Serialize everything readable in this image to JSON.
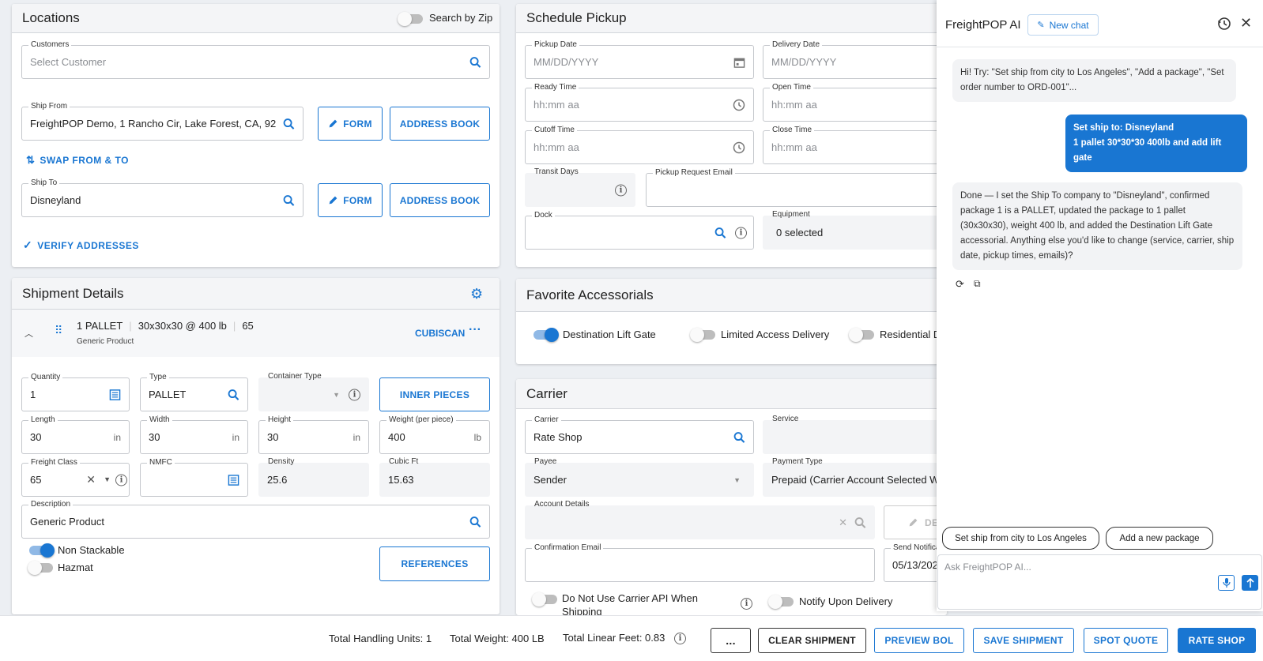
{
  "locations": {
    "title": "Locations",
    "search_by_zip": "Search by Zip",
    "customers_label": "Customers",
    "customers_placeholder": "Select Customer",
    "ship_from_label": "Ship From",
    "ship_from_value": "FreightPOP Demo, 1 Rancho Cir, Lake Forest, CA, 92...",
    "form_label": "FORM",
    "address_book_label": "ADDRESS BOOK",
    "swap_label": "SWAP FROM & TO",
    "ship_to_label": "Ship To",
    "ship_to_value": "Disneyland",
    "verify_label": "VERIFY ADDRESSES"
  },
  "shipment": {
    "title": "Shipment Details",
    "package_summary": "1 PALLET",
    "package_dims": "30x30x30 @ 400 lb",
    "package_class": "65",
    "package_sub": "Generic Product",
    "cubiscan_label": "CUBISCAN",
    "quantity_label": "Quantity",
    "quantity_value": "1",
    "type_label": "Type",
    "type_value": "PALLET",
    "container_label": "Container Type",
    "inner_pieces_label": "INNER PIECES",
    "length_label": "Length",
    "length_value": "30",
    "width_label": "Width",
    "width_value": "30",
    "height_label": "Height",
    "height_value": "30",
    "weight_label": "Weight (per piece)",
    "weight_value": "400",
    "unit_in": "in",
    "unit_lb": "lb",
    "class_label": "Freight Class",
    "class_value": "65",
    "nmfc_label": "NMFC",
    "density_label": "Density",
    "density_value": "25.6",
    "cubic_label": "Cubic Ft",
    "cubic_value": "15.63",
    "desc_label": "Description",
    "desc_value": "Generic Product",
    "non_stackable_label": "Non Stackable",
    "hazmat_label": "Hazmat",
    "references_label": "REFERENCES"
  },
  "pickup": {
    "title": "Schedule Pickup",
    "pickup_date_label": "Pickup Date",
    "date_placeholder": "MM/DD/YYYY",
    "delivery_date_label": "Delivery Date",
    "ready_label": "Ready Time",
    "time_placeholder": "hh:mm aa",
    "open_label": "Open Time",
    "cutoff_label": "Cutoff Time",
    "close_label": "Close Time",
    "transit_label": "Transit Days",
    "pickup_email_label": "Pickup Request Email",
    "dock_label": "Dock",
    "equipment_label": "Equipment",
    "equipment_value": "0 selected"
  },
  "accessorials": {
    "title": "Favorite Accessorials",
    "dest_lift": "Destination Lift Gate",
    "limited": "Limited Access Delivery",
    "residential": "Residential D"
  },
  "carrier": {
    "title": "Carrier",
    "carrier_label": "Carrier",
    "carrier_value": "Rate Shop",
    "service_label": "Service",
    "payee_label": "Payee",
    "payee_value": "Sender",
    "payment_label": "Payment Type",
    "payment_value": "Prepaid (Carrier Account Selected W",
    "account_label": "Account Details",
    "de_label": "DE",
    "confirm_label": "Confirmation Email",
    "send_label": "Send Notificat",
    "send_value": "05/13/202",
    "no_api_label": "Do Not Use Carrier API When Shipping",
    "notify_label": "Notify Upon Delivery"
  },
  "footer": {
    "handling": "Total Handling Units: 1",
    "weight": "Total Weight: 400 LB",
    "linear": "Total Linear Feet: 0.83",
    "more": "...",
    "clear": "CLEAR SHIPMENT",
    "preview": "PREVIEW BOL",
    "save": "SAVE SHIPMENT",
    "spot": "SPOT QUOTE",
    "rate": "RATE SHOP"
  },
  "ai": {
    "title": "FreightPOP AI",
    "new_chat": "New chat",
    "msg_hint": "Hi! Try: \"Set ship from city to Los Angeles\", \"Add a package\", \"Set order number to ORD-001\"...",
    "msg_user_line1": "Set ship to: Disneyland",
    "msg_user_line2": "1 pallet 30*30*30 400lb and add lift gate",
    "msg_reply": "Done — I set the Ship To company to \"Disneyland\", confirmed package 1 is a PALLET, updated the package to 1 pallet (30x30x30), weight 400 lb, and added the Destination Lift Gate accessorial. Anything else you'd like to change (service, carrier, ship date, pickup times, emails)?",
    "chip1": "Set ship from city to Los Angeles",
    "chip2": "Add a new package",
    "input_placeholder": "Ask FreightPOP AI..."
  },
  "colors": {
    "accent": "#1976d2",
    "toggle_on": "#90b9e6",
    "panel_header": "#f4f5f7"
  }
}
